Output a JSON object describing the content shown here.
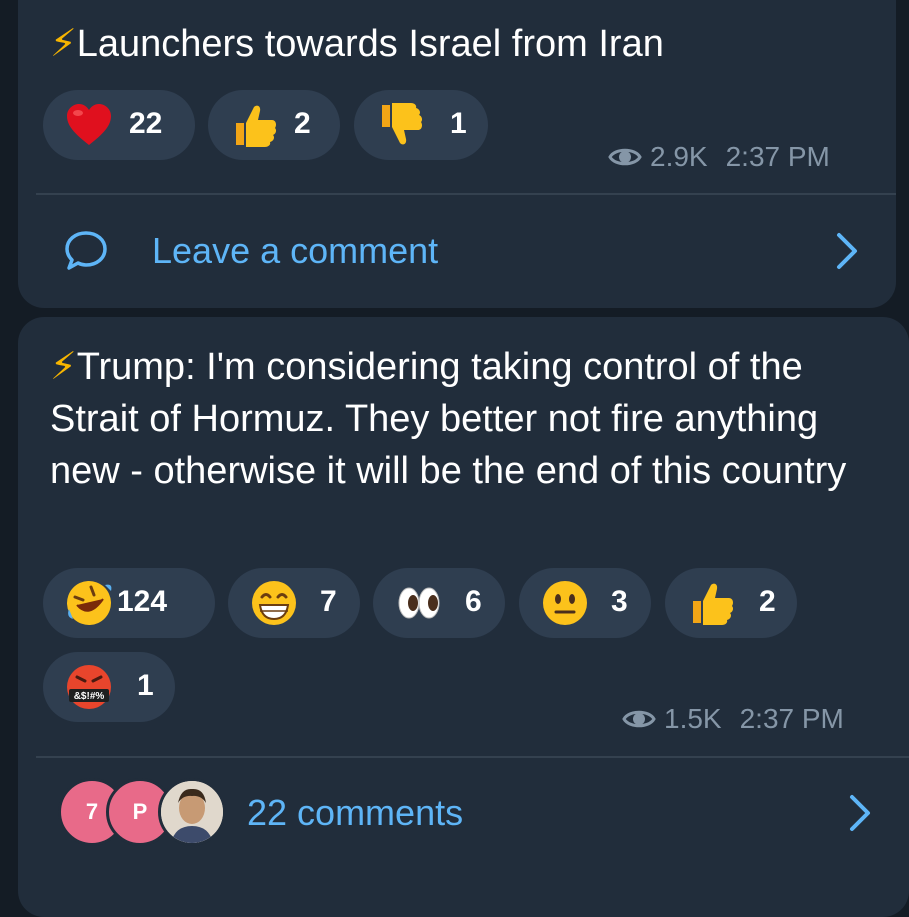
{
  "messages": [
    {
      "text": "Launchers towards Israel from Iran",
      "reactions": [
        {
          "icon": "red-heart-emoji",
          "count": "22"
        },
        {
          "icon": "thumbs-up-emoji",
          "count": "2"
        },
        {
          "icon": "thumbs-down-emoji",
          "count": "1"
        }
      ],
      "views": "2.9K",
      "time": "2:37 PM",
      "comment_label": "Leave a comment"
    },
    {
      "text": "Trump: I'm considering taking control of the Strait of Hormuz. They better not fire anything new - otherwise it will be the end of this country",
      "reactions": [
        {
          "icon": "rolling-laughing-emoji",
          "count": "124"
        },
        {
          "icon": "grinning-emoji",
          "count": "7"
        },
        {
          "icon": "eyes-emoji",
          "count": "6"
        },
        {
          "icon": "neutral-face-emoji",
          "count": "3"
        },
        {
          "icon": "thumbs-up-emoji",
          "count": "2"
        },
        {
          "icon": "cursing-face-emoji",
          "count": "1"
        }
      ],
      "views": "1.5K",
      "time": "2:37 PM",
      "comment_label": "22 comments",
      "avatars": [
        {
          "letter": "7",
          "color": "#e86a89"
        },
        {
          "letter": "P",
          "color": "#e86a89"
        },
        {
          "letter": "",
          "color": "#c9a27e"
        }
      ]
    }
  ],
  "colors": {
    "background": "#141c25",
    "bubble": "#212d3b",
    "reaction_pill": "#2f3e50",
    "link": "#5eb5f7",
    "meta": "#8596a7",
    "bolt": "#f7b500"
  },
  "cursing_symbols": "&$!#%"
}
